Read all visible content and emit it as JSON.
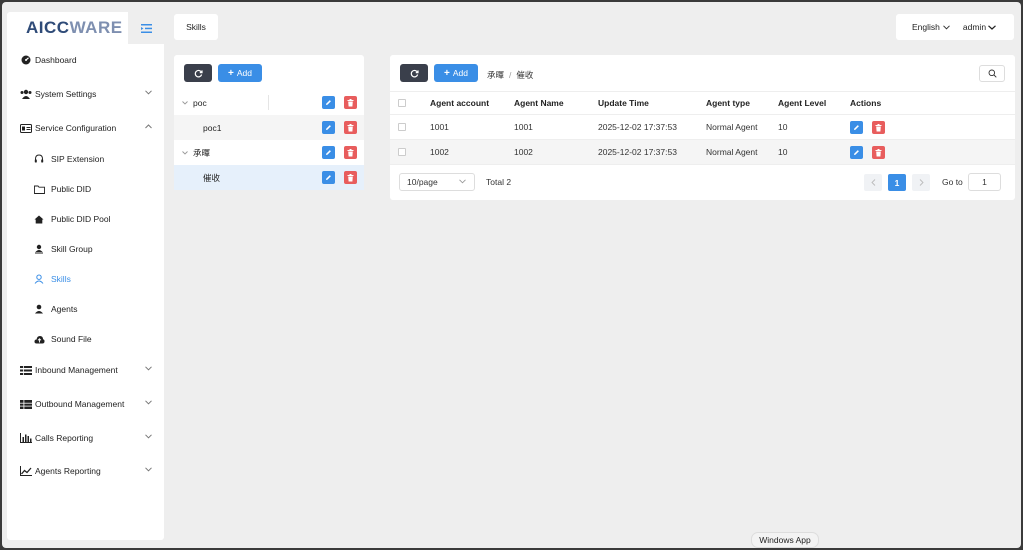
{
  "brand": {
    "logo_part1": "AICC",
    "logo_part2": "WARE"
  },
  "sidebar": {
    "items": [
      {
        "label": "Dashboard",
        "icon": "dashboard-icon"
      },
      {
        "label": "System Settings",
        "icon": "users-icon"
      },
      {
        "label": "Service Configuration",
        "icon": "id-card-icon"
      },
      {
        "label": "Inbound Management",
        "icon": "list-icon"
      },
      {
        "label": "Outbound Management",
        "icon": "table-icon"
      },
      {
        "label": "Calls Reporting",
        "icon": "bar-chart-icon"
      },
      {
        "label": "Agents Reporting",
        "icon": "line-chart-icon"
      }
    ],
    "sub_items": [
      {
        "label": "SIP Extension",
        "icon": "headset-icon"
      },
      {
        "label": "Public DID",
        "icon": "folder-icon"
      },
      {
        "label": "Public DID Pool",
        "icon": "home-icon"
      },
      {
        "label": "Skill Group",
        "icon": "user-group-icon"
      },
      {
        "label": "Skills",
        "icon": "user-outline-icon"
      },
      {
        "label": "Agents",
        "icon": "user-icon"
      },
      {
        "label": "Sound File",
        "icon": "cloud-upload-icon"
      }
    ]
  },
  "header": {
    "tab": "Skills",
    "language": "English",
    "user": "admin"
  },
  "tree": {
    "add_label": "Add",
    "nodes": [
      {
        "label": "poc",
        "level": 0
      },
      {
        "label": "poc1",
        "level": 1
      },
      {
        "label": "承暉",
        "level": 0
      },
      {
        "label": "催收",
        "level": 1
      }
    ]
  },
  "main": {
    "add_label": "Add",
    "breadcrumb": [
      "承暉",
      "催收"
    ],
    "columns": [
      "Agent account",
      "Agent Name",
      "Update Time",
      "Agent type",
      "Agent Level",
      "Actions"
    ],
    "rows": [
      [
        "1001",
        "1001",
        "2025-12-02 17:37:53",
        "Normal Agent",
        "10"
      ],
      [
        "1002",
        "1002",
        "2025-12-02 17:37:53",
        "Normal Agent",
        "10"
      ]
    ],
    "page_size": "10/page",
    "total": "Total 2",
    "current_page": "1",
    "goto_label": "Go to",
    "goto_value": "1"
  },
  "taskbar": {
    "tooltip": "Windows App"
  },
  "colors": {
    "primary": "#3a8ee6",
    "danger": "#e85d5d",
    "dark": "#3a3f4b"
  }
}
